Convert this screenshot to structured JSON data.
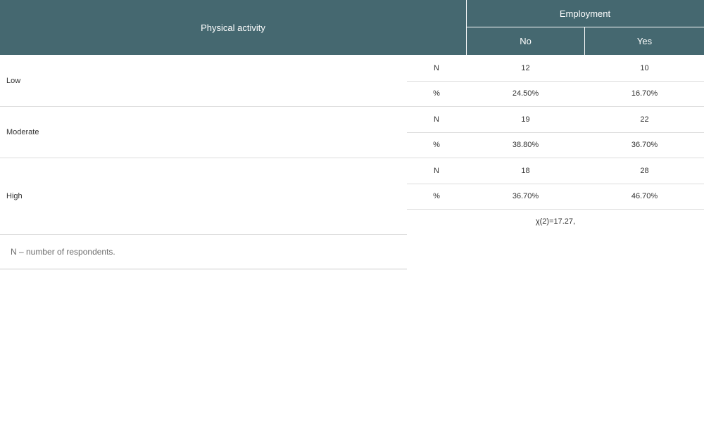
{
  "table": {
    "header": {
      "row_label": "Physical activity",
      "group_label": "Employment",
      "col_no": "No",
      "col_yes": "Yes"
    },
    "rows": [
      {
        "category": "Low",
        "n": {
          "label": "N",
          "no": "12",
          "yes": "10"
        },
        "pct": {
          "label": "%",
          "no": "24.50%",
          "yes": "16.70%"
        }
      },
      {
        "category": "Moderate",
        "n": {
          "label": "N",
          "no": "19",
          "yes": "22"
        },
        "pct": {
          "label": "%",
          "no": "38.80%",
          "yes": "36.70%"
        }
      },
      {
        "category": "High",
        "n": {
          "label": "N",
          "no": "18",
          "yes": "28"
        },
        "pct": {
          "label": "%",
          "no": "36.70%",
          "yes": "46.70%"
        }
      }
    ],
    "statistic": "χ(2)=17.27,",
    "footnote": "N – number of respondents."
  },
  "colors": {
    "header_bg": "#456870",
    "header_text": "#ffffff",
    "rule": "#dddddd",
    "body_text": "#333333",
    "note_text": "#6b6b6b"
  }
}
